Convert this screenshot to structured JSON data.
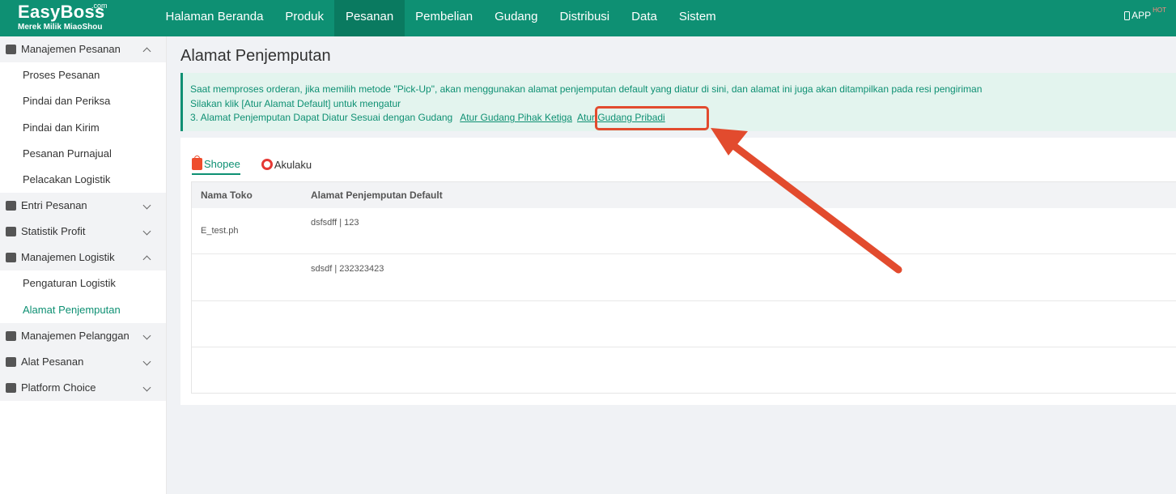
{
  "brand": {
    "name": "EasyBoss",
    "com": ".com",
    "tagline": "Merek Milik MiaoShou"
  },
  "nav": {
    "items": [
      "Halaman Beranda",
      "Produk",
      "Pesanan",
      "Pembelian",
      "Gudang",
      "Distribusi",
      "Data",
      "Sistem"
    ],
    "active": "Pesanan",
    "app_label": "APP",
    "hot_label": "HOT"
  },
  "sidebar": {
    "groups": [
      {
        "label": "Manajemen Pesanan",
        "open": true,
        "items": [
          "Proses Pesanan",
          "Pindai dan Periksa",
          "Pindai dan Kirim",
          "Pesanan Purnajual",
          "Pelacakan Logistik"
        ]
      },
      {
        "label": "Entri Pesanan",
        "open": false
      },
      {
        "label": "Statistik Profit",
        "open": false
      },
      {
        "label": "Manajemen Logistik",
        "open": true,
        "items": [
          "Pengaturan Logistik",
          "Alamat Penjemputan"
        ]
      },
      {
        "label": "Manajemen Pelanggan",
        "open": false
      },
      {
        "label": "Alat Pesanan",
        "open": false
      },
      {
        "label": "Platform Choice",
        "open": false
      }
    ],
    "active_item": "Alamat Penjemputan"
  },
  "page": {
    "title": "Alamat Penjemputan",
    "notice": {
      "line1": "Saat memproses orderan, jika memilih metode \"Pick-Up\", akan menggunakan alamat penjemputan default yang diatur di sini, dan alamat ini juga akan ditampilkan pada resi pengiriman",
      "line2": "Silakan klik [Atur Alamat Default] untuk mengatur",
      "line3": "3. Alamat Penjemputan Dapat Diatur Sesuai dengan Gudang",
      "link_third_party": "Atur Gudang Pihak Ketiga",
      "link_private": "Atur Gudang Pribadi"
    },
    "tabs": [
      {
        "label": "Shopee",
        "icon": "shopee-icon",
        "active": true
      },
      {
        "label": "Akulaku",
        "icon": "akulaku-icon",
        "active": false
      }
    ],
    "table": {
      "headers": [
        "Nama Toko",
        "Alamat Penjemputan Default"
      ],
      "rows": [
        {
          "name": "E_test.ph",
          "address": "dsfsdff | 123"
        },
        {
          "name": "",
          "address": "sdsdf | 232323423"
        },
        {
          "name": "",
          "address": ""
        },
        {
          "name": "",
          "address": ""
        }
      ]
    }
  },
  "colors": {
    "brand": "#0e9073",
    "highlight": "#e24b2e"
  }
}
